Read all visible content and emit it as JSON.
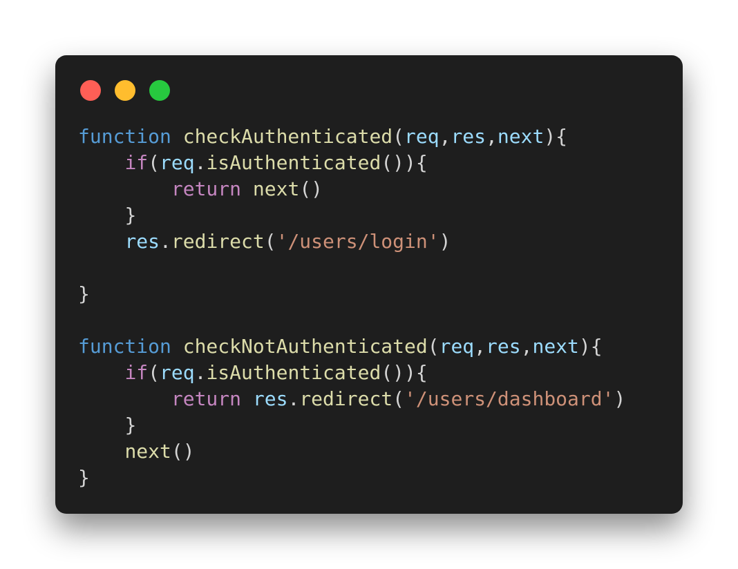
{
  "window": {
    "buttons": {
      "close_color": "#ff5f56",
      "minimize_color": "#ffbd2e",
      "zoom_color": "#27c93f"
    }
  },
  "code": {
    "language": "javascript",
    "lines": [
      [
        {
          "t": "function",
          "c": "kw"
        },
        {
          "t": " ",
          "c": "pn"
        },
        {
          "t": "checkAuthenticated",
          "c": "fn"
        },
        {
          "t": "(",
          "c": "pn"
        },
        {
          "t": "req",
          "c": "var"
        },
        {
          "t": ",",
          "c": "pn"
        },
        {
          "t": "res",
          "c": "var"
        },
        {
          "t": ",",
          "c": "pn"
        },
        {
          "t": "next",
          "c": "var"
        },
        {
          "t": "){",
          "c": "pn"
        }
      ],
      [
        {
          "t": "    ",
          "c": "pn"
        },
        {
          "t": "if",
          "c": "ctrl"
        },
        {
          "t": "(",
          "c": "pn"
        },
        {
          "t": "req",
          "c": "var"
        },
        {
          "t": ".",
          "c": "pn"
        },
        {
          "t": "isAuthenticated",
          "c": "fn"
        },
        {
          "t": "()){",
          "c": "pn"
        }
      ],
      [
        {
          "t": "        ",
          "c": "pn"
        },
        {
          "t": "return",
          "c": "ctrl"
        },
        {
          "t": " ",
          "c": "pn"
        },
        {
          "t": "next",
          "c": "fn"
        },
        {
          "t": "()",
          "c": "pn"
        }
      ],
      [
        {
          "t": "    ",
          "c": "pn"
        },
        {
          "t": "}",
          "c": "pn"
        }
      ],
      [
        {
          "t": "    ",
          "c": "pn"
        },
        {
          "t": "res",
          "c": "var"
        },
        {
          "t": ".",
          "c": "pn"
        },
        {
          "t": "redirect",
          "c": "fn"
        },
        {
          "t": "(",
          "c": "pn"
        },
        {
          "t": "'/users/login'",
          "c": "str"
        },
        {
          "t": ")",
          "c": "pn"
        }
      ],
      [],
      [
        {
          "t": "}",
          "c": "pn"
        }
      ],
      [],
      [
        {
          "t": "function",
          "c": "kw"
        },
        {
          "t": " ",
          "c": "pn"
        },
        {
          "t": "checkNotAuthenticated",
          "c": "fn"
        },
        {
          "t": "(",
          "c": "pn"
        },
        {
          "t": "req",
          "c": "var"
        },
        {
          "t": ",",
          "c": "pn"
        },
        {
          "t": "res",
          "c": "var"
        },
        {
          "t": ",",
          "c": "pn"
        },
        {
          "t": "next",
          "c": "var"
        },
        {
          "t": "){",
          "c": "pn"
        }
      ],
      [
        {
          "t": "    ",
          "c": "pn"
        },
        {
          "t": "if",
          "c": "ctrl"
        },
        {
          "t": "(",
          "c": "pn"
        },
        {
          "t": "req",
          "c": "var"
        },
        {
          "t": ".",
          "c": "pn"
        },
        {
          "t": "isAuthenticated",
          "c": "fn"
        },
        {
          "t": "()){",
          "c": "pn"
        }
      ],
      [
        {
          "t": "        ",
          "c": "pn"
        },
        {
          "t": "return",
          "c": "ctrl"
        },
        {
          "t": " ",
          "c": "pn"
        },
        {
          "t": "res",
          "c": "var"
        },
        {
          "t": ".",
          "c": "pn"
        },
        {
          "t": "redirect",
          "c": "fn"
        },
        {
          "t": "(",
          "c": "pn"
        },
        {
          "t": "'/users/dashboard'",
          "c": "str"
        },
        {
          "t": ")",
          "c": "pn"
        }
      ],
      [
        {
          "t": "    ",
          "c": "pn"
        },
        {
          "t": "}",
          "c": "pn"
        }
      ],
      [
        {
          "t": "    ",
          "c": "pn"
        },
        {
          "t": "next",
          "c": "fn"
        },
        {
          "t": "()",
          "c": "pn"
        }
      ],
      [
        {
          "t": "}",
          "c": "pn"
        }
      ]
    ]
  }
}
